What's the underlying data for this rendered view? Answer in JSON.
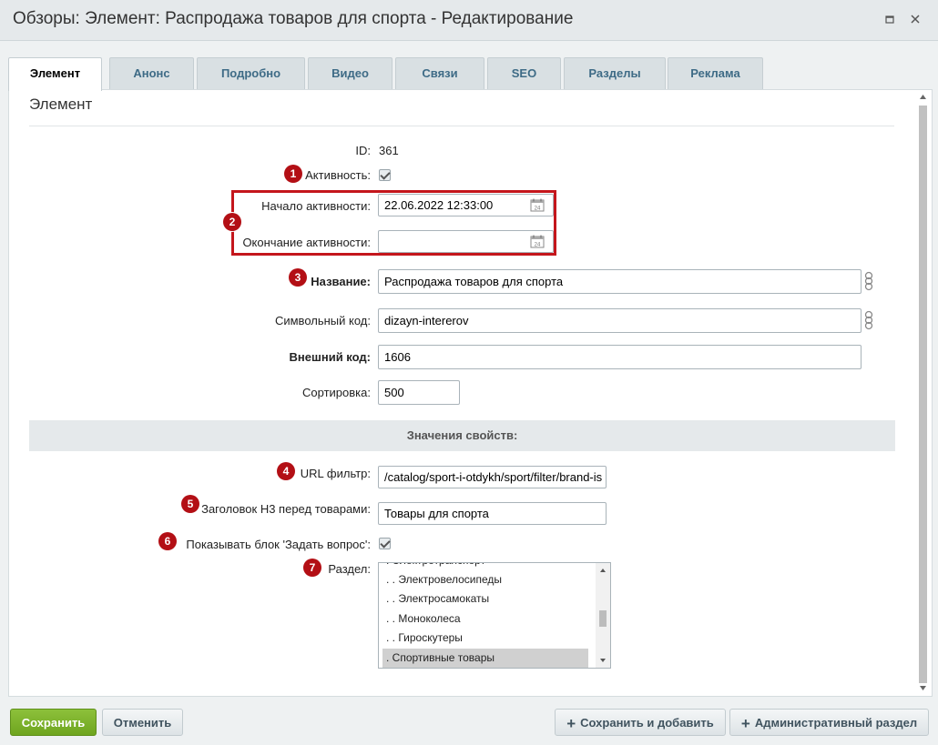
{
  "window": {
    "title": "Обзоры: Элемент: Распродажа товаров для спорта - Редактирование"
  },
  "tabs": [
    {
      "label": "Элемент",
      "active": true
    },
    {
      "label": "Анонс"
    },
    {
      "label": "Подробно"
    },
    {
      "label": "Видео"
    },
    {
      "label": "Связи"
    },
    {
      "label": "SEO"
    },
    {
      "label": "Разделы"
    },
    {
      "label": "Реклама"
    }
  ],
  "section_title": "Элемент",
  "fields": {
    "id": {
      "label": "ID:",
      "value": "361"
    },
    "active": {
      "label": "Активность:",
      "checked": true
    },
    "active_from": {
      "label": "Начало активности:",
      "value": "22.06.2022 12:33:00"
    },
    "active_to": {
      "label": "Окончание активности:",
      "value": ""
    },
    "name": {
      "label": "Название:",
      "value": "Распродажа товаров для спорта"
    },
    "code": {
      "label": "Символьный код:",
      "value": "dizayn-intererov"
    },
    "xml_id": {
      "label": "Внешний код:",
      "value": "1606"
    },
    "sort": {
      "label": "Сортировка:",
      "value": "500"
    }
  },
  "properties_header": "Значения свойств:",
  "properties": {
    "url_filter": {
      "label": "URL фильтр:",
      "value": "/catalog/sport-i-otdykh/sport/filter/brand-is"
    },
    "h3_title": {
      "label": "Заголовок H3 перед товарами:",
      "value": "Товары для спорта"
    },
    "show_ask_block": {
      "label": "Показывать блок 'Задать вопрос':",
      "checked": true
    },
    "section": {
      "label": "Раздел:",
      "options": [
        {
          "label": ". Электротранспорт"
        },
        {
          "label": ". . Электровелосипеды"
        },
        {
          "label": ". . Электросамокаты"
        },
        {
          "label": ". . Моноколеса"
        },
        {
          "label": ". . Гироскутеры"
        },
        {
          "label": ". Спортивные товары",
          "selected": true
        }
      ]
    }
  },
  "badges": [
    "1",
    "2",
    "3",
    "4",
    "5",
    "6",
    "7"
  ],
  "buttons": {
    "save": "Сохранить",
    "cancel": "Отменить",
    "save_and_add": "Сохранить и добавить",
    "admin_section": "Административный раздел"
  },
  "colors": {
    "annotation_red": "#c4161c",
    "badge_red": "#b30f15",
    "save_green": "#7ab02c",
    "tab_text": "#3e6b86"
  },
  "icons": [
    "restore-icon",
    "close-icon",
    "calendar-icon",
    "translit-icon",
    "plus-icon",
    "scroll-arrow-up-icon",
    "scroll-arrow-down-icon"
  ]
}
